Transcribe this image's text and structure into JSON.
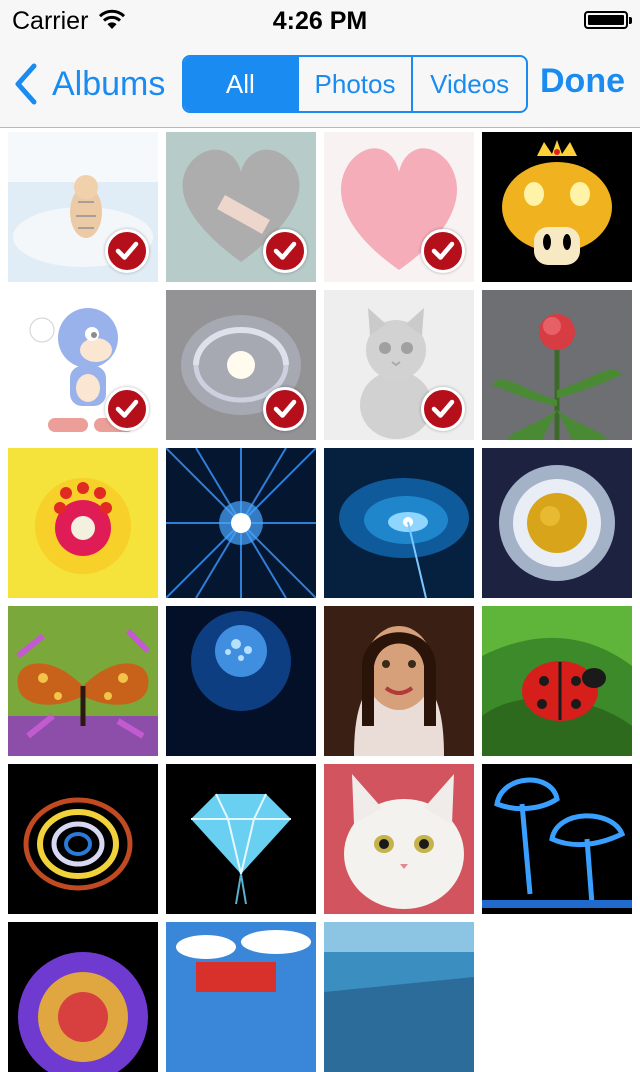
{
  "status_bar": {
    "carrier": "Carrier",
    "time": "4:26 PM"
  },
  "nav": {
    "back_label": "Albums",
    "segments": [
      "All",
      "Photos",
      "Videos"
    ],
    "selected_segment": "All",
    "done_label": "Done"
  },
  "colors": {
    "accent": "#1a8bf0",
    "check_badge": "#b40f1a"
  },
  "thumbnails": [
    {
      "name": "tiger-in-snow",
      "selected": true
    },
    {
      "name": "sparkly-heart-with-bandage",
      "selected": true
    },
    {
      "name": "pink-heart-on-paper",
      "selected": true
    },
    {
      "name": "golden-mushroom-on-black",
      "selected": false
    },
    {
      "name": "sonic-character",
      "selected": true
    },
    {
      "name": "spiral-galaxy",
      "selected": true
    },
    {
      "name": "gray-kitten",
      "selected": true
    },
    {
      "name": "red-flower-green-leaves",
      "selected": false
    },
    {
      "name": "yellow-hibiscus-flower",
      "selected": false
    },
    {
      "name": "blue-light-burst",
      "selected": false
    },
    {
      "name": "blue-spiral-vortex",
      "selected": false
    },
    {
      "name": "sun-with-white-rays",
      "selected": false
    },
    {
      "name": "butterfly-on-purple-flowers",
      "selected": false
    },
    {
      "name": "blue-underwater-bubbles",
      "selected": false
    },
    {
      "name": "woman-portrait",
      "selected": false
    },
    {
      "name": "ladybug-on-leaf",
      "selected": false
    },
    {
      "name": "glowing-abstract-rings",
      "selected": false
    },
    {
      "name": "blue-diamond",
      "selected": false
    },
    {
      "name": "white-cat-pink-cloth",
      "selected": false
    },
    {
      "name": "neon-blue-mushrooms",
      "selected": false
    },
    {
      "name": "partial-colorful-orb",
      "selected": false
    },
    {
      "name": "partial-red-car-sky",
      "selected": false
    },
    {
      "name": "partial-blue-sea",
      "selected": false
    }
  ]
}
